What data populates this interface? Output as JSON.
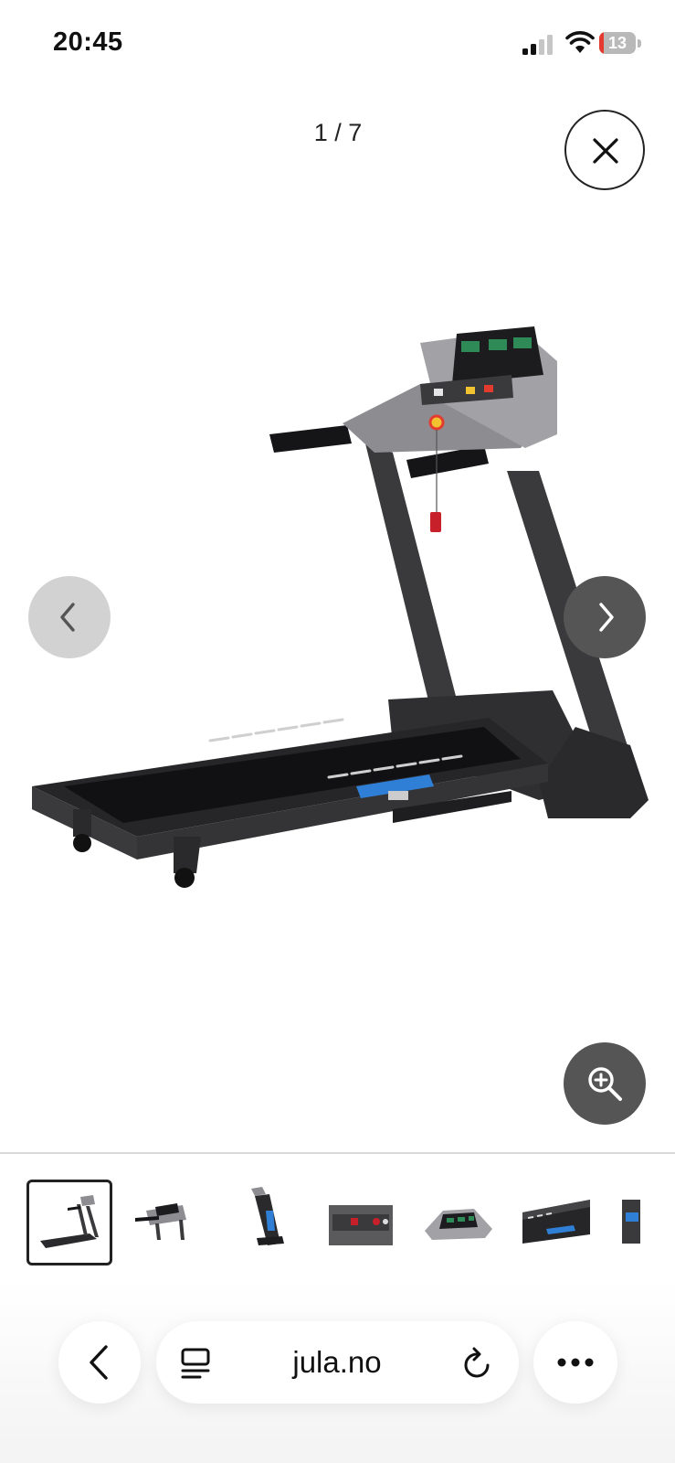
{
  "status_bar": {
    "time": "20:45",
    "battery_level": "13",
    "battery_charging": true,
    "icons": [
      "cellular-signal-icon",
      "wifi-icon",
      "battery-icon"
    ]
  },
  "gallery": {
    "counter": "1 / 7",
    "current_index": 1,
    "total": 7,
    "image_subject": "treadmill",
    "thumbnails": [
      {
        "subject": "treadmill-side-view",
        "selected": true
      },
      {
        "subject": "treadmill-console-view",
        "selected": false
      },
      {
        "subject": "treadmill-folded-view",
        "selected": false
      },
      {
        "subject": "control-panel-closeup",
        "selected": false
      },
      {
        "subject": "console-display-closeup",
        "selected": false
      },
      {
        "subject": "deck-closeup",
        "selected": false
      },
      {
        "subject": "partial-thumbnail",
        "selected": false
      }
    ],
    "controls": {
      "close_icon": "close-icon",
      "prev_icon": "chevron-left-icon",
      "next_icon": "chevron-right-icon",
      "zoom_icon": "zoom-in-icon"
    }
  },
  "browser_bar": {
    "url": "jula.no",
    "icons": [
      "back-icon",
      "tabs-icon",
      "reload-icon",
      "more-icon"
    ]
  },
  "colors": {
    "background": "#ffffff",
    "nav_next_bg": "#555555",
    "nav_prev_bg": "#d2d2d2",
    "battery_low": "#e43b30",
    "treadmill_accent": "#2f7fd6"
  }
}
